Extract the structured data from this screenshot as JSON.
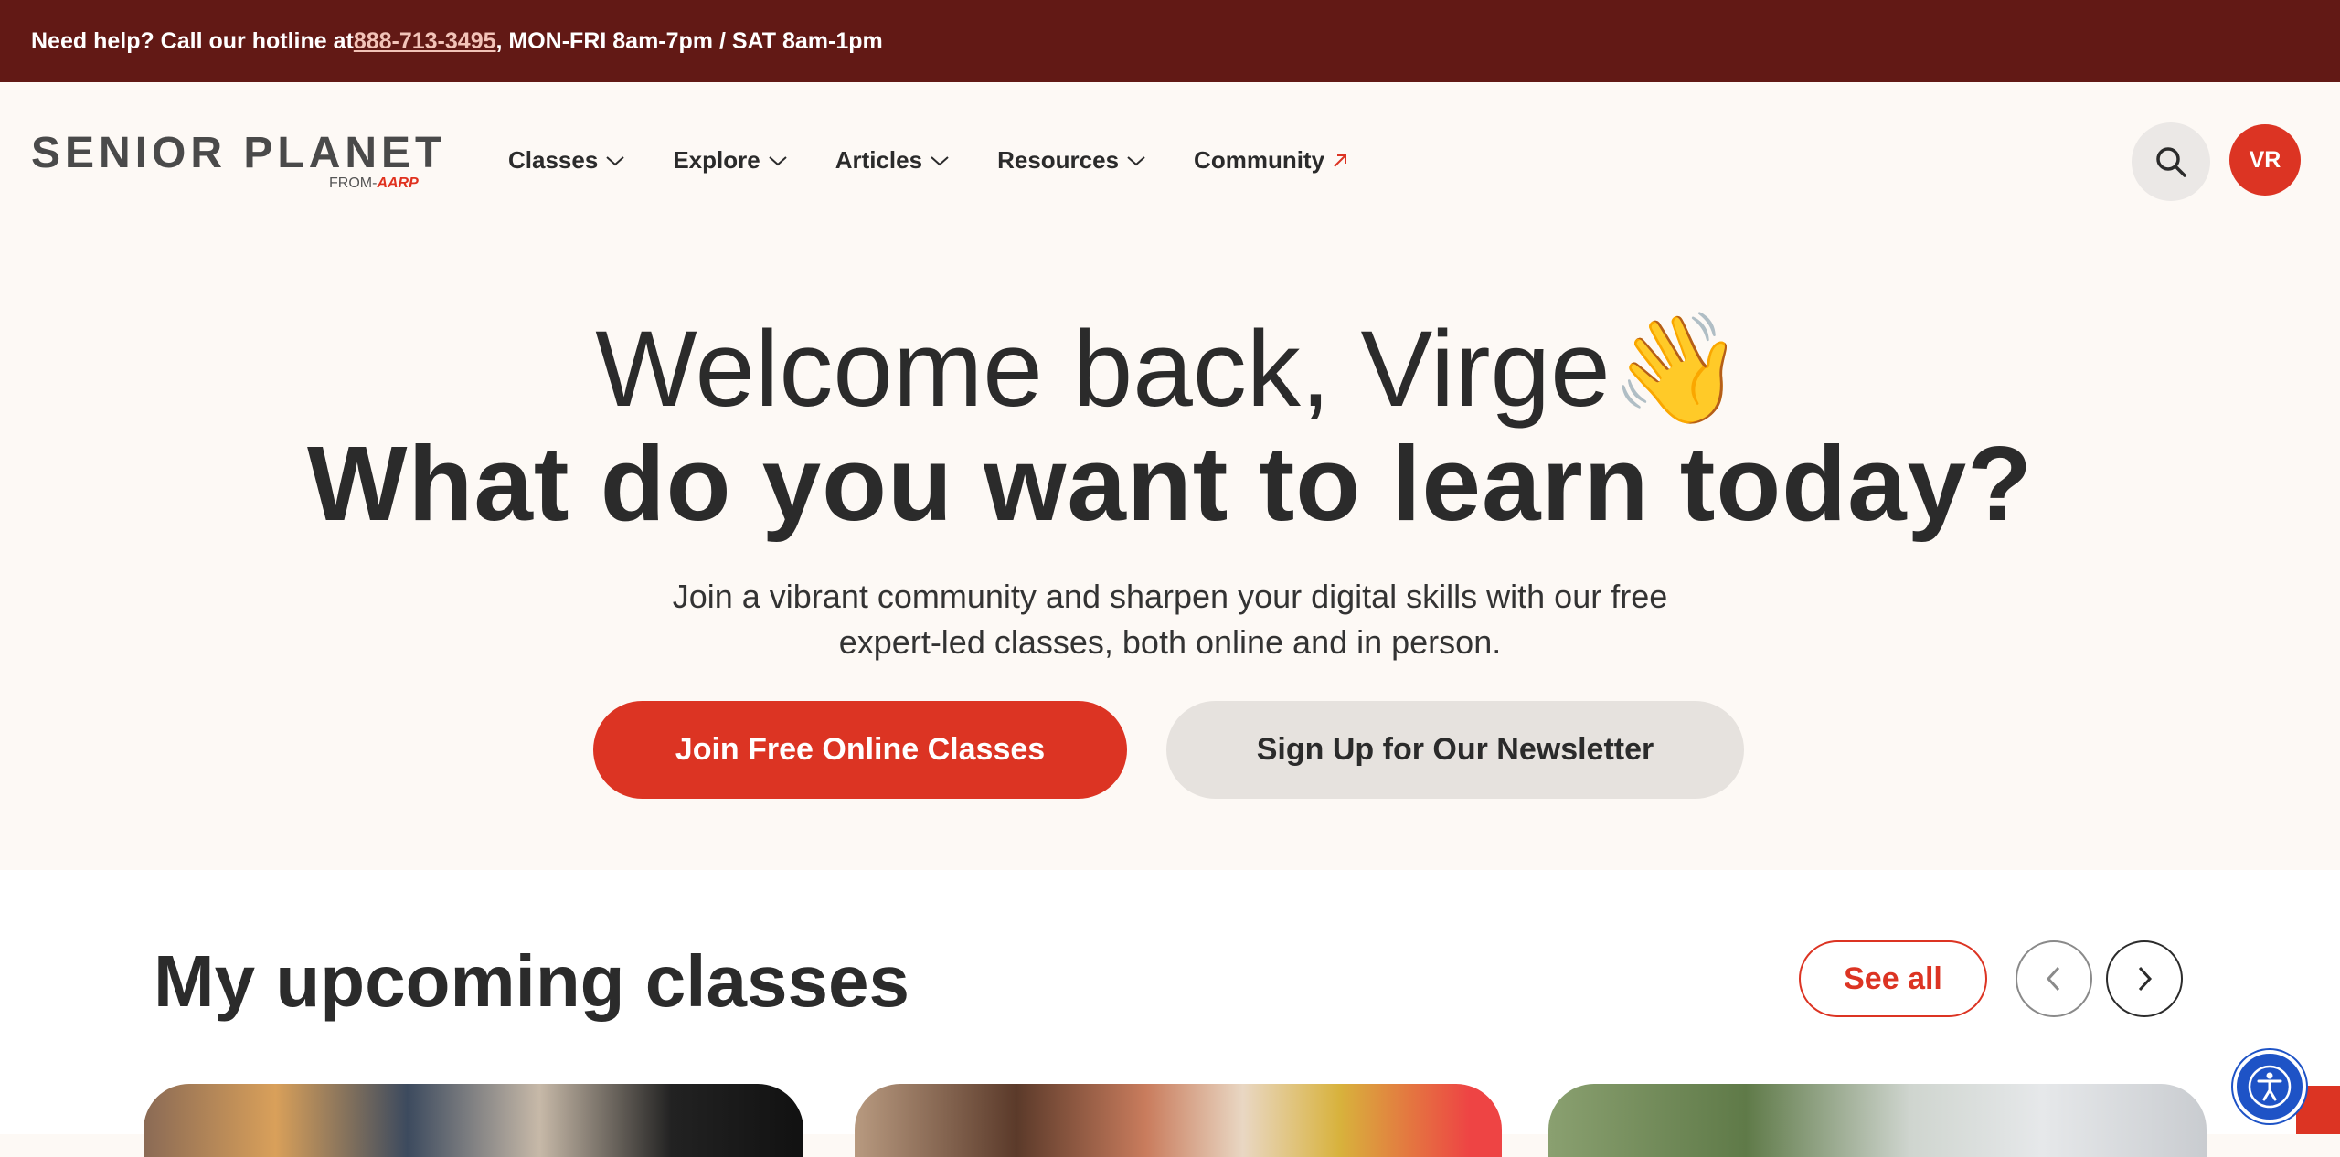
{
  "topbar": {
    "prefix": "Need help? Call our hotline at ",
    "phone": "888-713-3495",
    "suffix": ", MON-FRI 8am-7pm / SAT 8am-1pm"
  },
  "logo": {
    "main": "SENIOR PLANET",
    "from": "FROM",
    "brand": "AARP"
  },
  "nav": [
    {
      "label": "Classes",
      "icon": "chevron-down-icon"
    },
    {
      "label": "Explore",
      "icon": "chevron-down-icon"
    },
    {
      "label": "Articles",
      "icon": "chevron-down-icon"
    },
    {
      "label": "Resources",
      "icon": "chevron-down-icon"
    },
    {
      "label": "Community",
      "icon": "external-arrow-icon"
    }
  ],
  "user": {
    "initials": "VR"
  },
  "hero": {
    "welcome": "Welcome back, Virge",
    "wave": "👋",
    "question": "What do you want to learn today?",
    "intro_line1": "Join a vibrant community and sharpen your digital skills with our free",
    "intro_line2": "expert-led classes, both online and in person.",
    "primary_cta": "Join Free Online Classes",
    "secondary_cta": "Sign Up for Our Newsletter"
  },
  "upcoming": {
    "title": "My upcoming classes",
    "see_all": "See all"
  },
  "colors": {
    "topbar": "#621915",
    "accent": "#dc3423",
    "background": "#fdf9f5",
    "accessibility": "#1e53c6"
  }
}
